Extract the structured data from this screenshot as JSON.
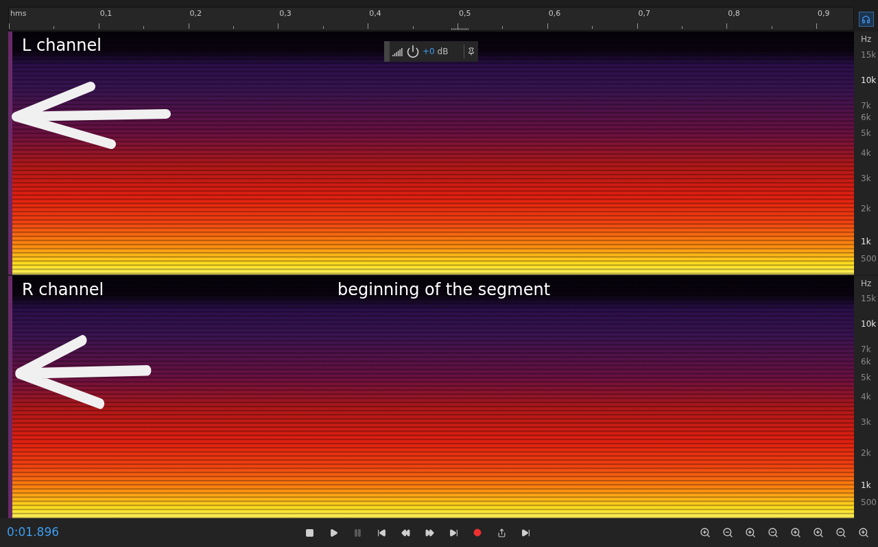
{
  "ruler": {
    "unit": "hms",
    "ticks": [
      "0,1",
      "0,2",
      "0,3",
      "0,4",
      "0,5",
      "0,6",
      "0,7",
      "0,8",
      "0,9"
    ]
  },
  "hud": {
    "gain_prefix": "+0",
    "gain_unit": "dB"
  },
  "channels": [
    {
      "label": "L channel",
      "frequency_axis": {
        "unit": "Hz",
        "labels": [
          {
            "text": "15k",
            "kind": "minor"
          },
          {
            "text": "10k",
            "kind": "major"
          },
          {
            "text": "7k",
            "kind": "minor"
          },
          {
            "text": "6k",
            "kind": "minor"
          },
          {
            "text": "5k",
            "kind": "minor"
          },
          {
            "text": "4k",
            "kind": "minor"
          },
          {
            "text": "3k",
            "kind": "minor"
          },
          {
            "text": "2k",
            "kind": "minor"
          },
          {
            "text": "1k",
            "kind": "major"
          },
          {
            "text": "500",
            "kind": "minor"
          }
        ]
      }
    },
    {
      "label": "R channel",
      "annotation": "beginning of the segment",
      "frequency_axis": {
        "unit": "Hz",
        "labels": [
          {
            "text": "15k",
            "kind": "minor"
          },
          {
            "text": "10k",
            "kind": "major"
          },
          {
            "text": "7k",
            "kind": "minor"
          },
          {
            "text": "6k",
            "kind": "minor"
          },
          {
            "text": "5k",
            "kind": "minor"
          },
          {
            "text": "4k",
            "kind": "minor"
          },
          {
            "text": "3k",
            "kind": "minor"
          },
          {
            "text": "2k",
            "kind": "minor"
          },
          {
            "text": "1k",
            "kind": "major"
          },
          {
            "text": "500",
            "kind": "minor"
          }
        ]
      }
    }
  ],
  "transport": {
    "time": "0:01.896",
    "buttons": [
      {
        "kind": "stop",
        "disabled": false
      },
      {
        "kind": "play",
        "disabled": false
      },
      {
        "kind": "pause",
        "disabled": true
      },
      {
        "kind": "start",
        "disabled": false
      },
      {
        "kind": "rewind",
        "disabled": false
      },
      {
        "kind": "forward",
        "disabled": false
      },
      {
        "kind": "end",
        "disabled": false
      },
      {
        "kind": "record",
        "disabled": false
      },
      {
        "kind": "output",
        "disabled": false
      },
      {
        "kind": "skip",
        "disabled": false
      }
    ]
  },
  "zoom_tools": [
    {
      "kind": "zoom-in-amp"
    },
    {
      "kind": "zoom-out-amp"
    },
    {
      "kind": "zoom-in-time"
    },
    {
      "kind": "zoom-out-time"
    },
    {
      "kind": "zoom-full"
    },
    {
      "kind": "zoom-in-left"
    },
    {
      "kind": "zoom-out-right"
    },
    {
      "kind": "zoom-selection"
    }
  ]
}
